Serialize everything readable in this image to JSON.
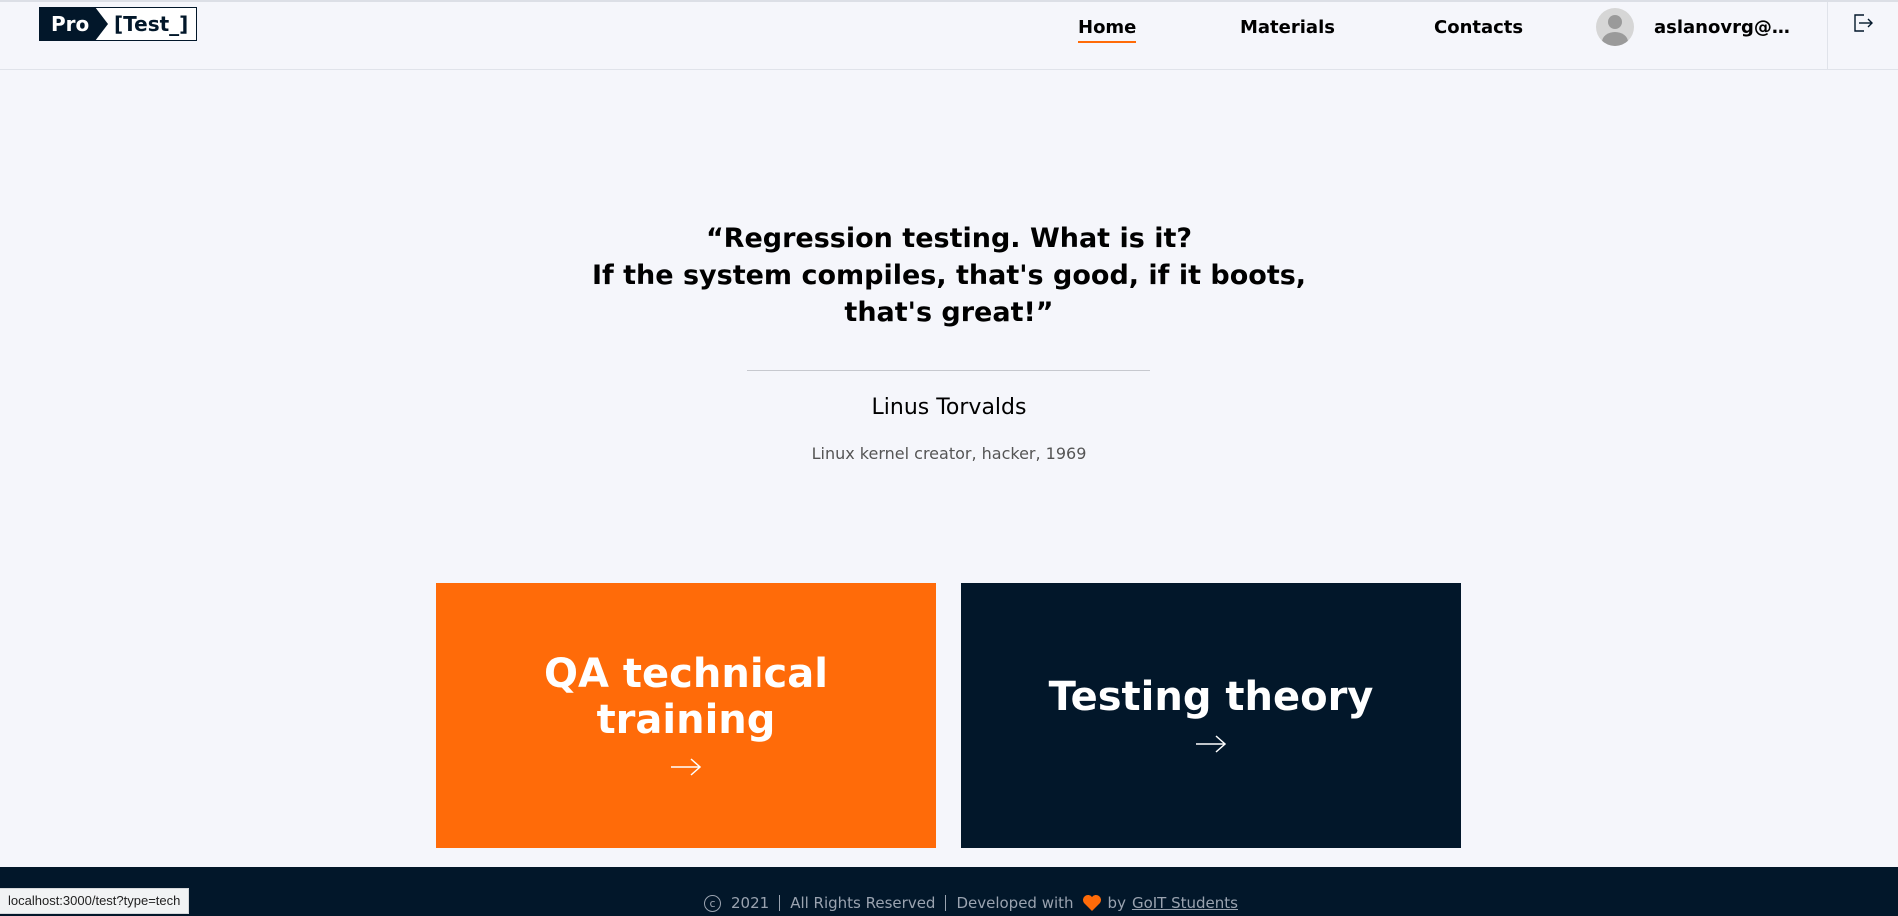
{
  "header": {
    "logo_pro": "Pro",
    "logo_test": "[Test_]",
    "nav": [
      {
        "label": "Home",
        "active": true
      },
      {
        "label": "Materials",
        "active": false
      },
      {
        "label": "Contacts",
        "active": false
      }
    ],
    "user_email": "aslanovrg@g..."
  },
  "quote": {
    "line1": "“Regression testing. What is it?",
    "line2": "If the system compiles, that's good, if it boots, that's great!”",
    "author": "Linus Torvalds",
    "author_desc": "Linux kernel creator, hacker, 1969"
  },
  "cards": [
    {
      "title": "QA technical training",
      "color": "#ff6b09"
    },
    {
      "title": "Testing theory",
      "color": "#02172a"
    }
  ],
  "footer": {
    "year": "2021",
    "rights": "All Rights Reserved",
    "developed_with": "Developed with",
    "by": "by",
    "team_link": "GoIT Students"
  },
  "status_bar": {
    "url": "localhost:3000/test?type=tech"
  },
  "colors": {
    "accent": "#ff6b09",
    "dark": "#02172a",
    "background": "#f5f6fb"
  }
}
